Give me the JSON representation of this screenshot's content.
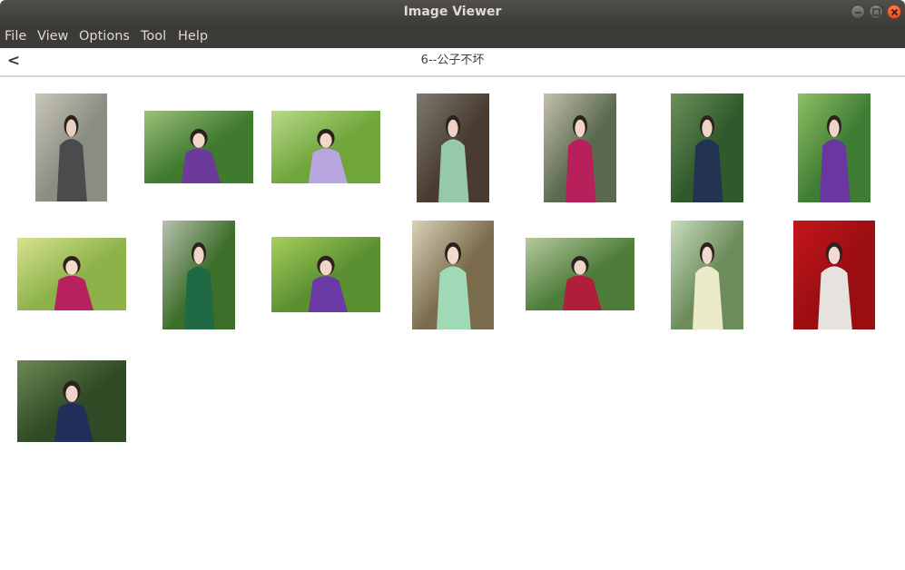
{
  "window": {
    "title": "Image Viewer",
    "buttons": [
      "minimize-button",
      "maximize-button",
      "close-button"
    ]
  },
  "menu": [
    "File",
    "View",
    "Options",
    "Tool",
    "Help"
  ],
  "header": {
    "back_label": "<",
    "folder_title": "6--公子不坏"
  },
  "thumbnails": [
    {
      "bg": "#8a8d82",
      "bg2": "#c9c6b8",
      "figure": "#4b4a4c",
      "skin": "#e8cfc0",
      "orientation": "portrait"
    },
    {
      "bg": "#3f7a2f",
      "bg2": "#9dc07a",
      "figure": "#6b3a9a",
      "skin": "#f0d7c8",
      "orientation": "landscape"
    },
    {
      "bg": "#6fa53a",
      "bg2": "#b9d98a",
      "figure": "#b9a6e0",
      "skin": "#f2d8c8",
      "orientation": "landscape"
    },
    {
      "bg": "#4a3b30",
      "bg2": "#7d7a6e",
      "figure": "#96c9aa",
      "skin": "#efd2c4",
      "orientation": "portrait"
    },
    {
      "bg": "#5b6a4f",
      "bg2": "#c5c0ad",
      "figure": "#b8205c",
      "skin": "#f1d6c8",
      "orientation": "portrait"
    },
    {
      "bg": "#2f5a2c",
      "bg2": "#6e8f5a",
      "figure": "#233352",
      "skin": "#efd4c5",
      "orientation": "portrait"
    },
    {
      "bg": "#3f7d35",
      "bg2": "#8fc063",
      "figure": "#6a37a1",
      "skin": "#efd4c5",
      "orientation": "portrait"
    },
    {
      "bg": "#8db24a",
      "bg2": "#d7e28f",
      "figure": "#b6215e",
      "skin": "#f3dccc",
      "orientation": "landscape"
    },
    {
      "bg": "#3d6e2a",
      "bg2": "#b8c0b0",
      "figure": "#1f6a45",
      "skin": "#f0d6c8",
      "orientation": "portrait"
    },
    {
      "bg": "#5a8f32",
      "bg2": "#a7cf5a",
      "figure": "#6c3aa5",
      "skin": "#f0d6c8",
      "orientation": "landscape"
    },
    {
      "bg": "#7b6b4d",
      "bg2": "#d9d2b9",
      "figure": "#9fd9b6",
      "skin": "#f2dacd",
      "orientation": "portrait"
    },
    {
      "bg": "#4e7d3b",
      "bg2": "#b7c99d",
      "figure": "#b01e3a",
      "skin": "#f0d6c8",
      "orientation": "landscape"
    },
    {
      "bg": "#6c8c5a",
      "bg2": "#c9dcc0",
      "figure": "#ecebc9",
      "skin": "#f1dbd0",
      "orientation": "portrait"
    },
    {
      "bg": "#9a0e12",
      "bg2": "#c4161c",
      "figure": "#e5e2e0",
      "skin": "#f2dad0",
      "orientation": "portrait"
    },
    {
      "bg": "#2f4a25",
      "bg2": "#6d8752",
      "figure": "#20305a",
      "skin": "#f0d4c5",
      "orientation": "landscape"
    }
  ]
}
